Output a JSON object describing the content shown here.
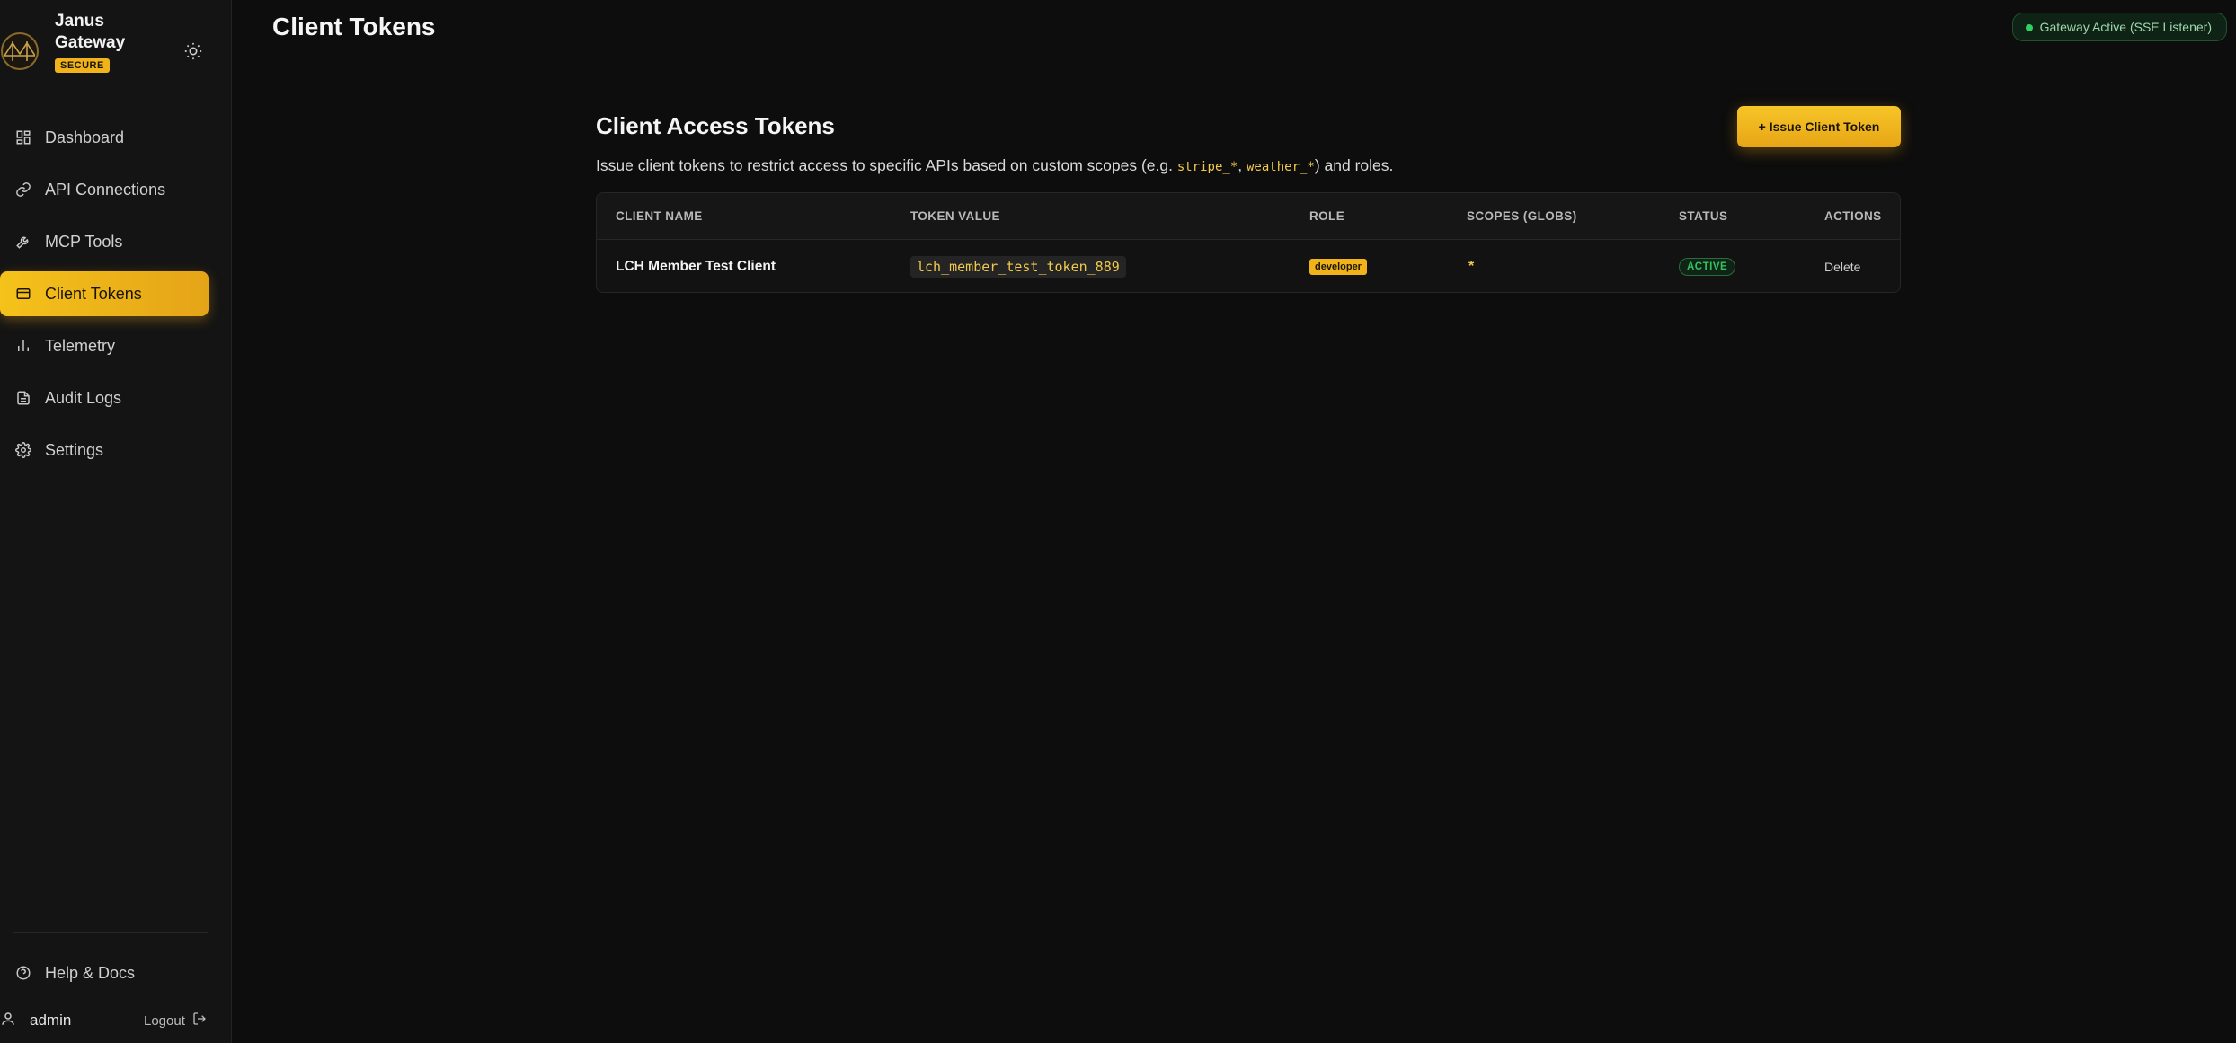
{
  "brand": {
    "name": "Janus Gateway",
    "badge": "SECURE"
  },
  "sidebar": {
    "items": [
      {
        "label": "Dashboard",
        "icon": "dashboard-grid-icon"
      },
      {
        "label": "API Connections",
        "icon": "link-icon"
      },
      {
        "label": "MCP Tools",
        "icon": "wrench-icon"
      },
      {
        "label": "Client Tokens",
        "icon": "credit-card-icon",
        "active": true
      },
      {
        "label": "Telemetry",
        "icon": "bar-chart-icon"
      },
      {
        "label": "Audit Logs",
        "icon": "document-icon"
      },
      {
        "label": "Settings",
        "icon": "gear-icon"
      }
    ],
    "help_label": "Help & Docs",
    "user_name": "admin",
    "logout_label": "Logout"
  },
  "header": {
    "title": "Client Tokens",
    "gateway_status": "Gateway Active (SSE Listener)"
  },
  "main": {
    "section_title": "Client Access Tokens",
    "desc_prefix": "Issue client tokens to restrict access to specific APIs based on custom scopes (e.g. ",
    "desc_code1": "stripe_*",
    "desc_sep": ", ",
    "desc_code2": "weather_*",
    "desc_suffix": ") and roles.",
    "issue_button": "+ Issue Client Token",
    "table": {
      "columns": [
        "CLIENT NAME",
        "TOKEN VALUE",
        "ROLE",
        "SCOPES (GLOBS)",
        "STATUS",
        "ACTIONS"
      ],
      "rows": [
        {
          "client_name": "LCH Member Test Client",
          "token_value": "lch_member_test_token_889",
          "role": "developer",
          "scopes": "*",
          "status": "ACTIVE",
          "action": "Delete"
        }
      ]
    }
  },
  "colors": {
    "accent": "#f0b31a",
    "background": "#0d0d0d",
    "sidebar": "#141414",
    "status_green": "#2fd061"
  }
}
